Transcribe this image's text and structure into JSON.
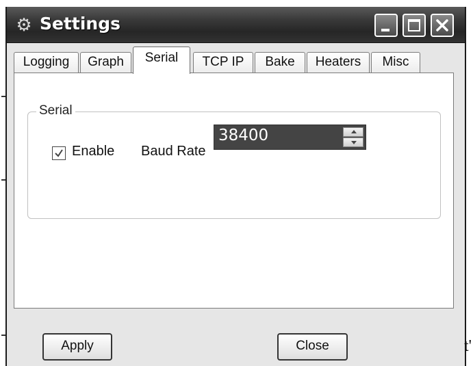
{
  "window": {
    "title": "Settings",
    "title_icon": "gear-icon"
  },
  "tabs": [
    {
      "label": "Logging",
      "active": false
    },
    {
      "label": "Graph",
      "active": false
    },
    {
      "label": "Serial",
      "active": true
    },
    {
      "label": "TCP IP",
      "active": false
    },
    {
      "label": "Bake",
      "active": false
    },
    {
      "label": "Heaters",
      "active": false
    },
    {
      "label": "Misc",
      "active": false
    }
  ],
  "serial": {
    "group_label": "Serial",
    "enable_label": "Enable",
    "enable_checked": true,
    "baud_rate_label": "Baud Rate",
    "baud_rate_value": "38400"
  },
  "footer": {
    "apply_label": "Apply",
    "close_label": "Close"
  },
  "edge_text": "t'",
  "colors": {
    "titlebar": "#2e2e2e",
    "window_bg": "#e6e6e6",
    "panel_bg": "#ffffff",
    "spinner_bg": "#444444"
  }
}
